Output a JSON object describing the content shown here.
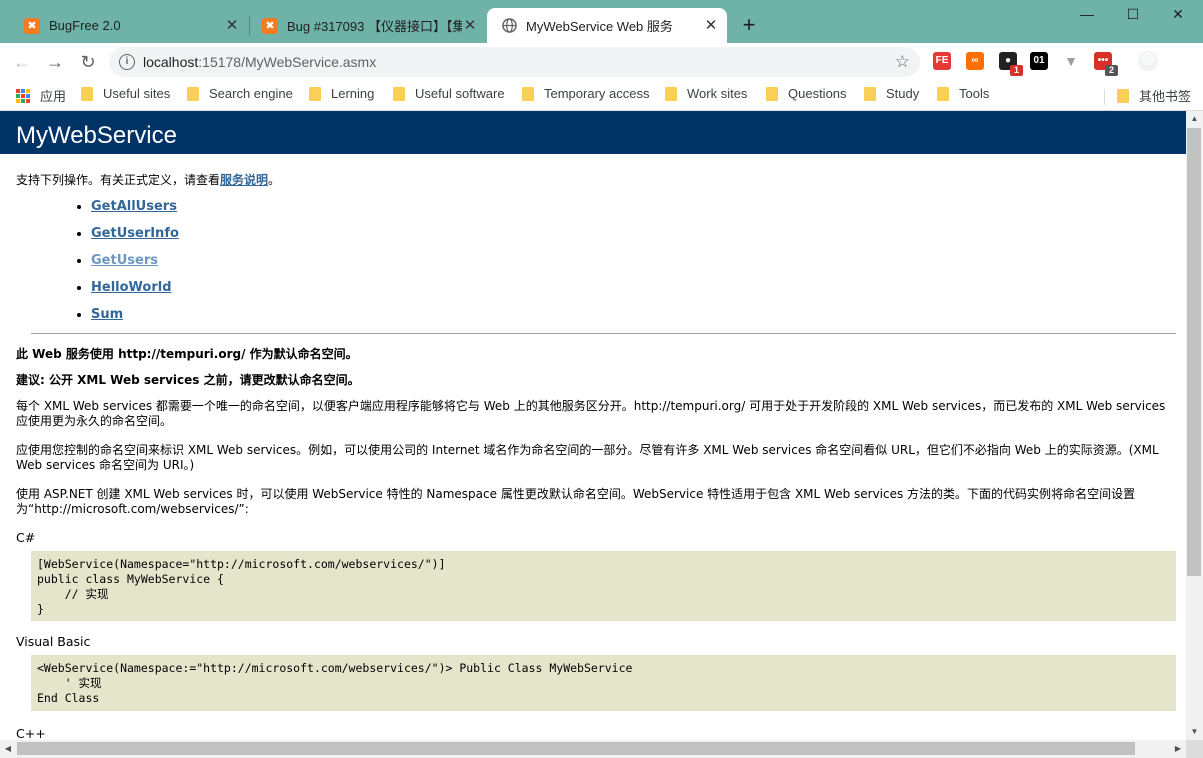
{
  "browser": {
    "tabs": [
      {
        "title": "BugFree 2.0",
        "icon": "bugfree-icon",
        "active": false
      },
      {
        "title": "Bug #317093 【仪器接口】【集",
        "icon": "bugfree-icon",
        "active": false
      },
      {
        "title": "MyWebService Web 服务",
        "icon": "globe-icon",
        "active": true
      }
    ],
    "new_tab": "+",
    "window": {
      "minimize": "—",
      "maximize": "☐",
      "close": "✕"
    },
    "url_host": "localhost",
    "url_path": ":15178/MyWebService.asmx",
    "extensions": [
      {
        "name": "fe-extension-icon",
        "label": "FE",
        "color": "#e53935"
      },
      {
        "name": "infinity-extension-icon",
        "label": "∞",
        "color": "#ff6f00"
      },
      {
        "name": "onenote-extension-icon",
        "label": "●",
        "color": "#222222",
        "badge": "1",
        "badge_color": "#d93025"
      },
      {
        "name": "binary-extension-icon",
        "label": "01",
        "color": "#000000"
      },
      {
        "name": "vue-devtools-icon",
        "label": "▼",
        "color": "#9e9e9e"
      },
      {
        "name": "dots-extension-icon",
        "label": "•••",
        "color": "#d93025",
        "badge": "2",
        "badge_color": "#555555"
      },
      {
        "name": "profile-avatar-icon",
        "label": "😜",
        "color": "#f1f3f4"
      }
    ]
  },
  "bookmarks": {
    "apps": "应用",
    "items": [
      "Useful sites",
      "Search engine",
      "Lerning",
      "Useful software",
      "Temporary access",
      "Work sites",
      "Questions",
      "Study",
      "Tools"
    ],
    "other": "其他书签"
  },
  "page": {
    "heading": "MyWebService",
    "intro_text": "支持下列操作。有关正式定义，请查看",
    "intro_link": "服务说明",
    "intro_end": "。",
    "operations": [
      "GetAllUsers",
      "GetUserInfo",
      "GetUsers",
      "HelloWorld",
      "Sum"
    ],
    "ns_notice": "此 Web 服务使用 http://tempuri.org/ 作为默认命名空间。",
    "recommendation": "建议: 公开 XML Web services 之前，请更改默认命名空间。",
    "para1": "每个 XML Web services 都需要一个唯一的命名空间，以便客户端应用程序能够将它与 Web 上的其他服务区分开。http://tempuri.org/ 可用于处于开发阶段的 XML Web services，而已发布的 XML Web services 应使用更为永久的命名空间。",
    "para2": "应使用您控制的命名空间来标识 XML Web services。例如，可以使用公司的 Internet 域名作为命名空间的一部分。尽管有许多 XML Web services 命名空间看似 URL，但它们不必指向 Web 上的实际资源。(XML Web services 命名空间为 URI。)",
    "para3": "使用 ASP.NET 创建 XML Web services 时，可以使用 WebService 特性的 Namespace 属性更改默认命名空间。WebService 特性适用于包含 XML Web services 方法的类。下面的代码实例将命名空间设置为“http://microsoft.com/webservices/”:",
    "csharp_label": "C#",
    "csharp_code": "[WebService(Namespace=\"http://microsoft.com/webservices/\")]\npublic class MyWebService {\n    // 实现\n}",
    "vb_label": "Visual Basic",
    "vb_code": "<WebService(Namespace:=\"http://microsoft.com/webservices/\")> Public Class MyWebService\n    ' 实现\nEnd Class",
    "cpp_label": "C++"
  }
}
